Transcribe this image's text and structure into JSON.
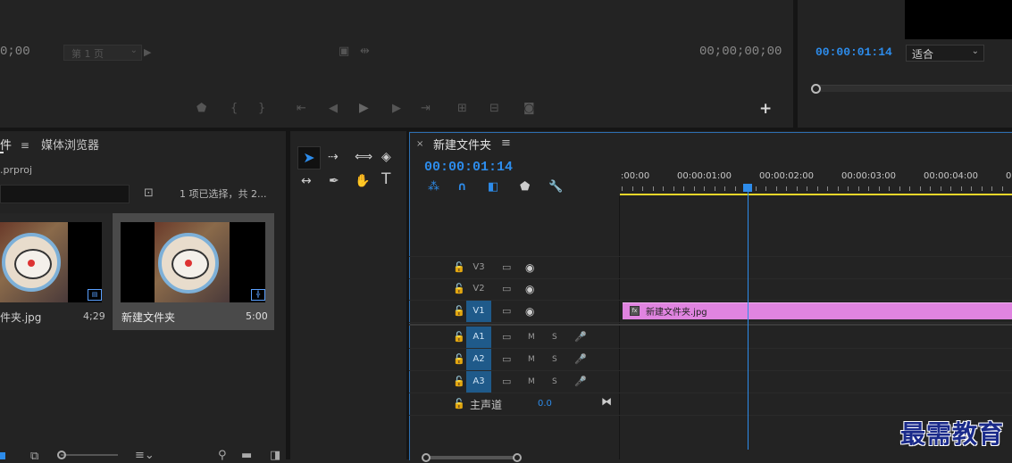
{
  "source_monitor": {
    "timecode_left": "0;00",
    "page_select": "第 1 页",
    "timecode_right": "00;00;00;00"
  },
  "program_monitor": {
    "timecode": "00:00:01:14",
    "zoom_select": "适合"
  },
  "project_panel": {
    "tab_project_partial": "件",
    "tab_media_browser": "媒体浏览器",
    "project_file": ".prproj",
    "selection_info": "1 项已选择，共 2...",
    "items": [
      {
        "name": "件夹.jpg",
        "duration": "4;29"
      },
      {
        "name": "新建文件夹",
        "duration": "5:00"
      }
    ]
  },
  "timeline": {
    "tab_title": "新建文件夹",
    "playhead_timecode": "00:00:01:14",
    "ruler_labels": [
      ":00:00",
      "00:00:01:00",
      "00:00:02:00",
      "00:00:03:00",
      "00:00:04:00",
      "0"
    ],
    "tracks": [
      {
        "name": "V3",
        "active": false
      },
      {
        "name": "V2",
        "active": false
      },
      {
        "name": "V1",
        "active": true
      },
      {
        "name": "A1",
        "active": true
      },
      {
        "name": "A2",
        "active": true
      },
      {
        "name": "A3",
        "active": true
      }
    ],
    "audio_m": "M",
    "audio_s": "S",
    "master_label": "主声道",
    "master_value": "0.0",
    "clip_name": "新建文件夹.jpg"
  },
  "watermark": "最需教育",
  "colors": {
    "accent": "#2d8ceb",
    "clip": "#e084e0",
    "workarea": "#e8d62a"
  }
}
